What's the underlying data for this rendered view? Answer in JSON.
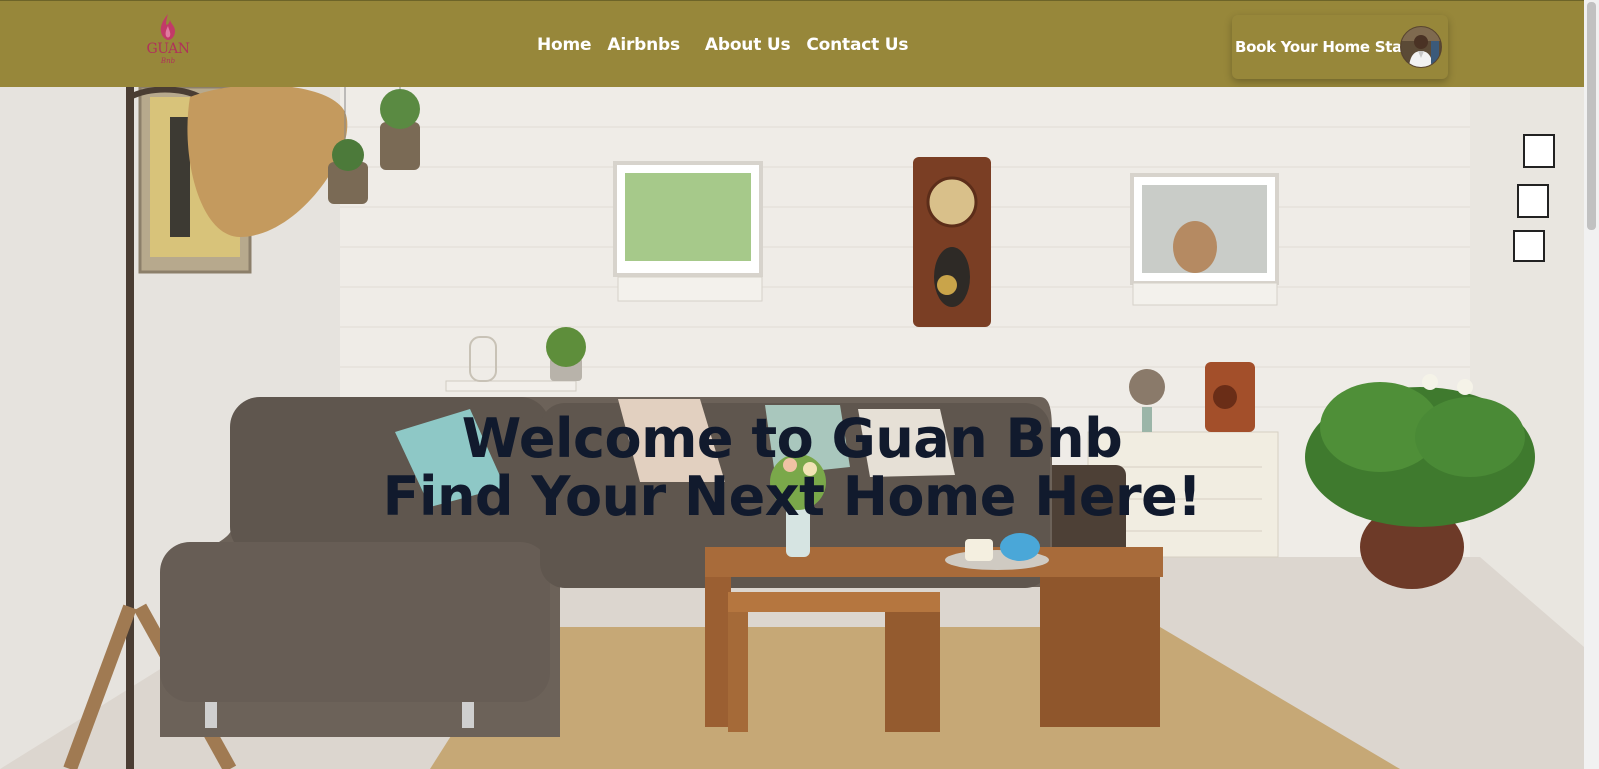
{
  "logo": {
    "name": "GUAN",
    "sub": "Bnb",
    "icon": "flame-icon",
    "color": "#b0325a"
  },
  "nav": {
    "links": [
      "Home",
      "Airbnbs",
      "About Us",
      "Contact Us"
    ],
    "book_label": "Book Your Home Stay",
    "avatar_icon": "user-avatar"
  },
  "hero": {
    "line1": "Welcome to Guan Bnb",
    "line2": "Find Your Next Home Here!"
  },
  "colors": {
    "navbar": "#97873a",
    "headline": "#111a2d",
    "nav_text": "#ffffff"
  }
}
